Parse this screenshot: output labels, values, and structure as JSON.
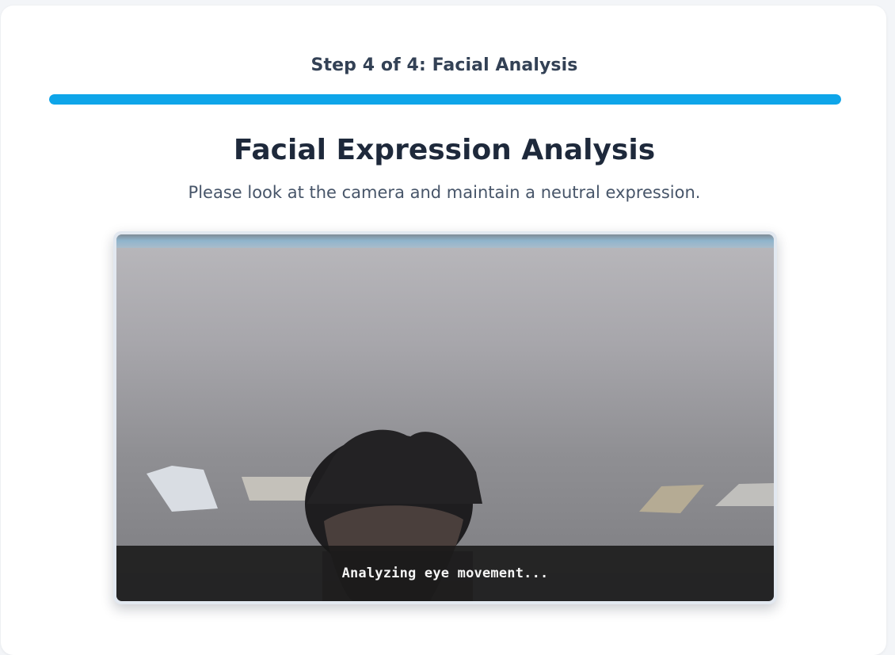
{
  "header": {
    "step_label": "Step 4 of 4: Facial Analysis",
    "progress_fraction": 1.0,
    "progress_color": "#0ea5e9"
  },
  "main": {
    "title": "Facial Expression Analysis",
    "subtitle": "Please look at the camera and maintain a neutral expression."
  },
  "camera": {
    "status_text": "Analyzing eye movement...",
    "feed_description_icon": "camera-feed"
  },
  "colors": {
    "accent": "#0ea5e9",
    "title": "#1e293b",
    "text": "#475569",
    "card": "#ffffff",
    "page": "#f3f5f8"
  }
}
